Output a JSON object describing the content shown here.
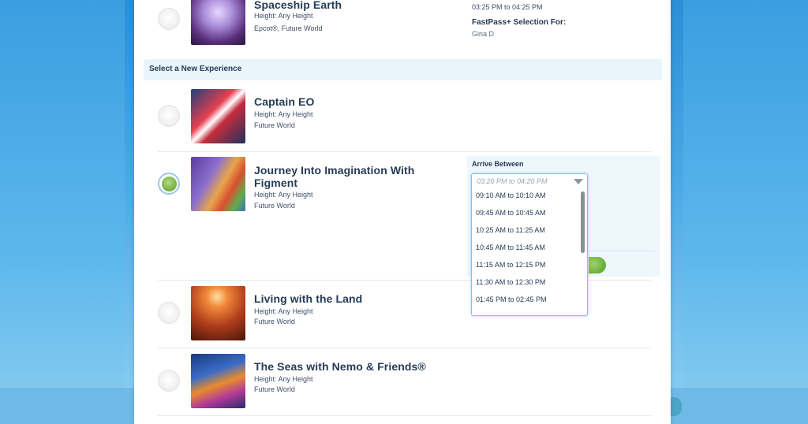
{
  "top_experience": {
    "title": "Spaceship Earth",
    "height": "Height: Any Height",
    "location": "Epcot®, Future World",
    "time": "03:25 PM to 04:25 PM",
    "fastpass_label": "FastPass+ Selection For:",
    "guest_name": "Gina D"
  },
  "section": {
    "header": "Select a New Experience"
  },
  "experiences": [
    {
      "title": "Captain EO",
      "height": "Height: Any Height",
      "location": "Future World"
    },
    {
      "title_line1": "Journey Into Imagination With",
      "title_line2": "Figment",
      "height": "Height: Any Height",
      "location": "Future World"
    },
    {
      "title": "Living with the Land",
      "height": "Height: Any Height",
      "location": "Future World"
    },
    {
      "title": "The Seas with Nemo & Friends®",
      "height": "Height: Any Height",
      "location": "Future World"
    }
  ],
  "arrive": {
    "label": "Arrive Between",
    "selected": "03:20 PM to 04:20 PM",
    "options": [
      "09:10 AM to 10:10 AM",
      "09:45 AM to 10:45 AM",
      "10:25 AM to 11:25 AM",
      "10:45 AM to 11:45 AM",
      "11:15 AM to 12:15 PM",
      "11:30 AM to 12:30 PM",
      "01:45 PM to 02:45 PM"
    ]
  },
  "colors": {
    "accent_green": "#7ab54b",
    "header_bg": "#eaf5fb",
    "text_dark": "#253b56",
    "dropdown_border": "#7fc2e6"
  },
  "icons": {
    "radio": "radio-button",
    "dropdown": "chevron-down-icon"
  }
}
